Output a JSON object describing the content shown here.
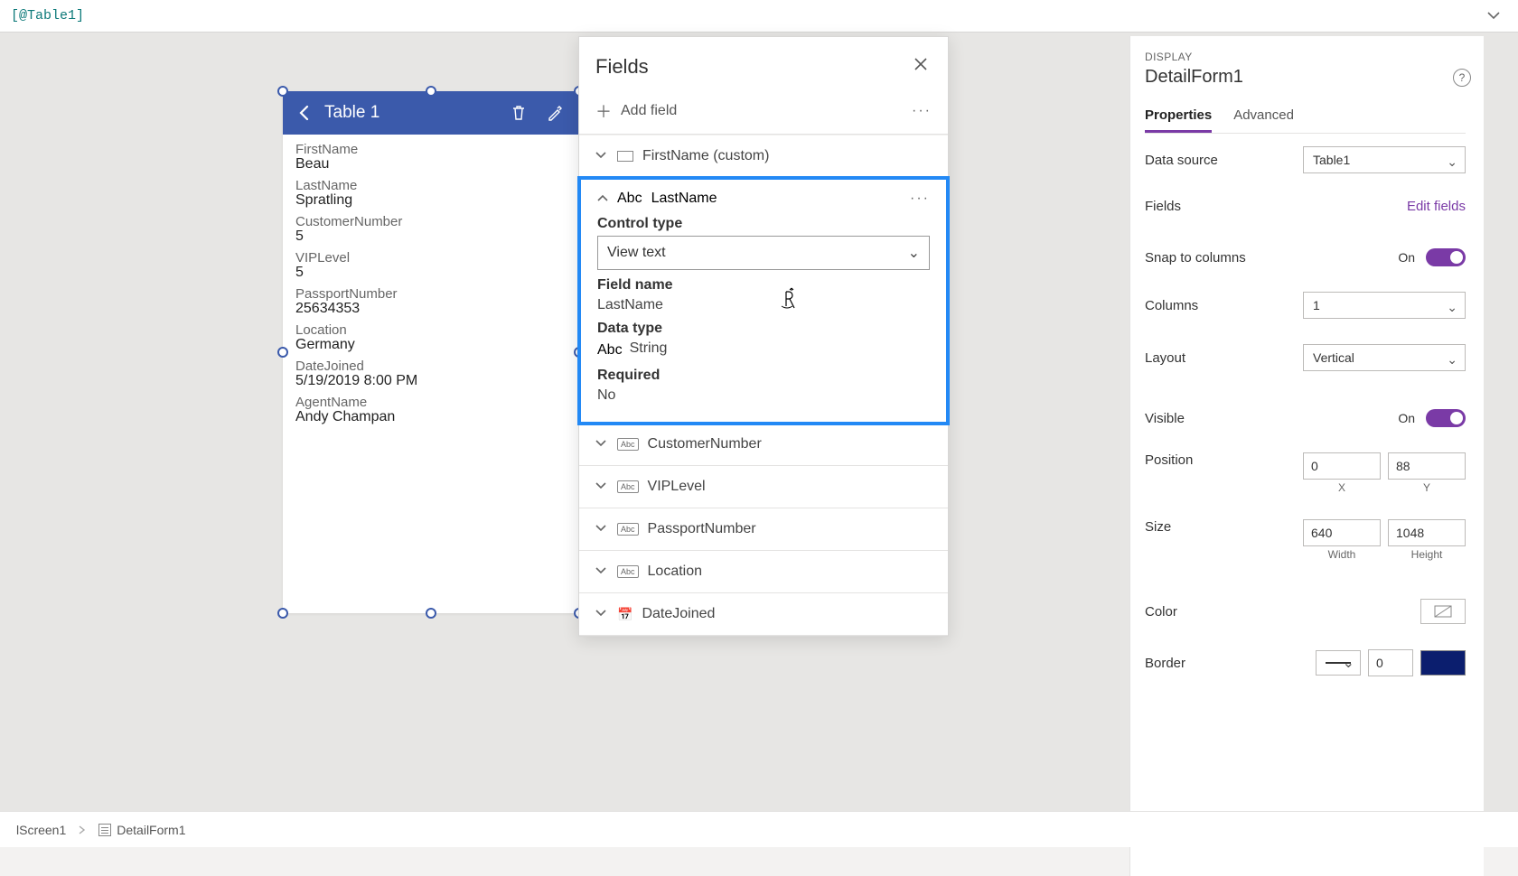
{
  "formula": "[@Table1]",
  "canvas": {
    "title": "Table 1",
    "records": [
      {
        "label": "FirstName",
        "value": "Beau"
      },
      {
        "label": "LastName",
        "value": "Spratling"
      },
      {
        "label": "CustomerNumber",
        "value": "5"
      },
      {
        "label": "VIPLevel",
        "value": "5"
      },
      {
        "label": "PassportNumber",
        "value": "25634353"
      },
      {
        "label": "Location",
        "value": "Germany"
      },
      {
        "label": "DateJoined",
        "value": "5/19/2019 8:00 PM"
      },
      {
        "label": "AgentName",
        "value": "Andy Champan"
      }
    ]
  },
  "fieldsPanel": {
    "title": "Fields",
    "addField": "Add field",
    "items": [
      {
        "icon": "rect",
        "name": "FirstName (custom)",
        "expanded": false
      },
      {
        "icon": "abc",
        "name": "LastName",
        "expanded": true
      },
      {
        "icon": "abc",
        "name": "CustomerNumber",
        "expanded": false
      },
      {
        "icon": "abc",
        "name": "VIPLevel",
        "expanded": false
      },
      {
        "icon": "abc",
        "name": "PassportNumber",
        "expanded": false
      },
      {
        "icon": "abc",
        "name": "Location",
        "expanded": false
      },
      {
        "icon": "date",
        "name": "DateJoined",
        "expanded": false
      }
    ],
    "expandedDetail": {
      "controlTypeLabel": "Control type",
      "controlType": "View text",
      "fieldNameLabel": "Field name",
      "fieldName": "LastName",
      "dataTypeLabel": "Data type",
      "dataType": "String",
      "requiredLabel": "Required",
      "required": "No"
    }
  },
  "propsPanel": {
    "sectionTag": "DISPLAY",
    "name": "DetailForm1",
    "tabs": {
      "properties": "Properties",
      "advanced": "Advanced"
    },
    "dataSourceLabel": "Data source",
    "dataSourceValue": "Table1",
    "fieldsLabel": "Fields",
    "editFields": "Edit fields",
    "snapLabel": "Snap to columns",
    "snapValue": "On",
    "columnsLabel": "Columns",
    "columnsValue": "1",
    "layoutLabel": "Layout",
    "layoutValue": "Vertical",
    "visibleLabel": "Visible",
    "visibleValue": "On",
    "positionLabel": "Position",
    "positionX": "0",
    "positionY": "88",
    "xCap": "X",
    "yCap": "Y",
    "sizeLabel": "Size",
    "sizeW": "640",
    "sizeH": "1048",
    "wCap": "Width",
    "hCap": "Height",
    "colorLabel": "Color",
    "borderLabel": "Border",
    "borderWidth": "0"
  },
  "breadcrumb": {
    "screen": "lScreen1",
    "control": "DetailForm1"
  }
}
